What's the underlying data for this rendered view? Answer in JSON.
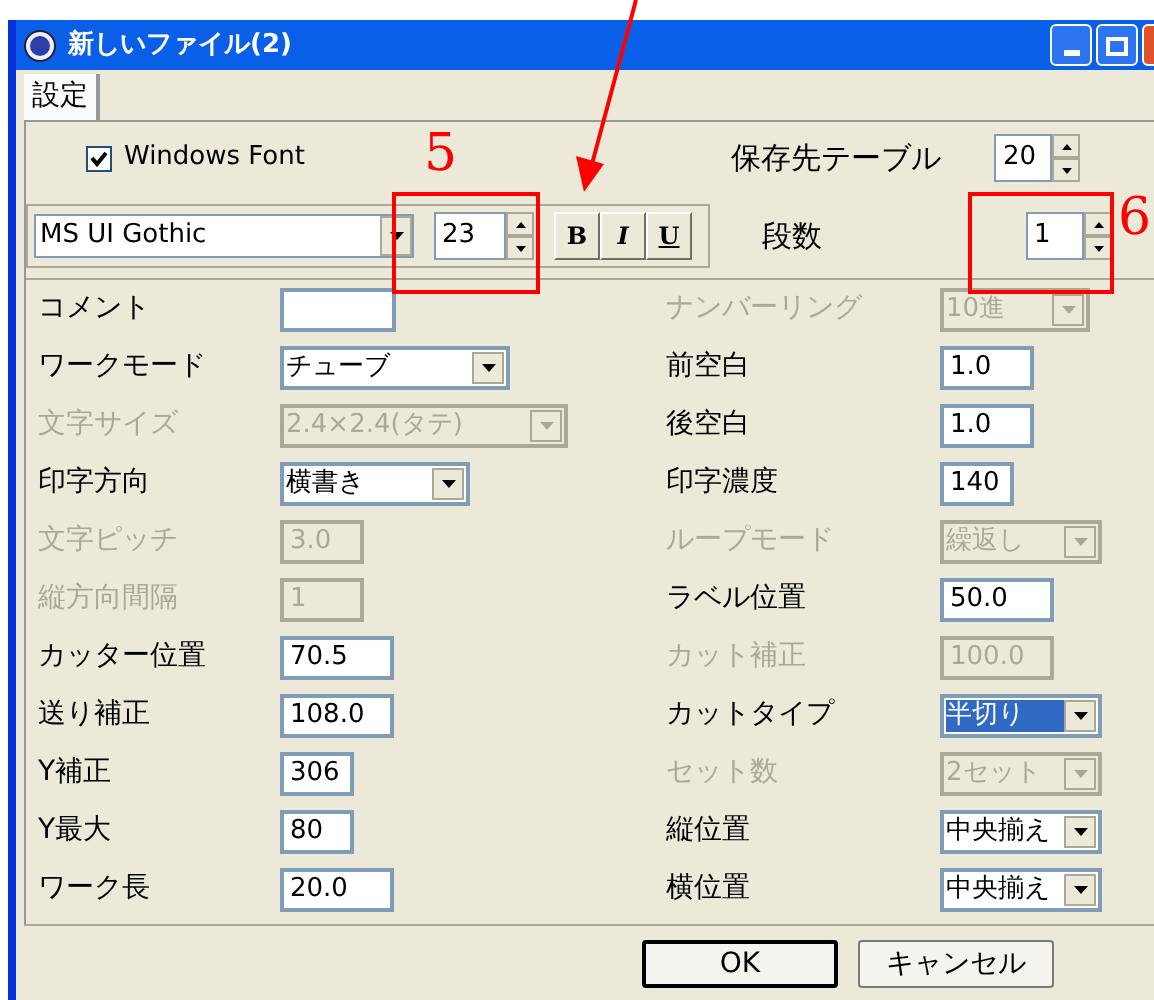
{
  "window": {
    "title": "新しいファイル(2)"
  },
  "tabs": [
    {
      "label": "設定",
      "selected": true
    }
  ],
  "windows_font": {
    "label": "Windows Font",
    "checked": true
  },
  "save_table": {
    "label": "保存先テーブル",
    "value": "20"
  },
  "font_row": {
    "font": "MS UI Gothic",
    "size": "23",
    "style_buttons": [
      "B",
      "I",
      "U"
    ]
  },
  "columns_count": {
    "label": "段数",
    "value": "1"
  },
  "left_fields": [
    {
      "label": "コメント",
      "kind": "text",
      "disabled": false
    },
    {
      "label": "ワークモード",
      "kind": "combo",
      "value": "チューブ",
      "disabled": false
    },
    {
      "label": "文字サイズ",
      "kind": "combo",
      "value": "2.4×2.4(タテ)",
      "disabled": true
    },
    {
      "label": "印字方向",
      "kind": "combo",
      "value": "横書き",
      "disabled": false
    },
    {
      "label": "文字ピッチ",
      "kind": "text",
      "value": "3.0",
      "disabled": true
    },
    {
      "label": "縦方向間隔",
      "kind": "text",
      "value": "1",
      "disabled": true
    },
    {
      "label": "カッター位置",
      "kind": "text",
      "value": "70.5",
      "disabled": false
    },
    {
      "label": "送り補正",
      "kind": "text",
      "value": "108.0",
      "disabled": false
    },
    {
      "label": "Y補正",
      "kind": "text",
      "value": "306",
      "disabled": false
    },
    {
      "label": "Y最大",
      "kind": "text",
      "value": "80",
      "disabled": false
    },
    {
      "label": "ワーク長",
      "kind": "text",
      "value": "20.0",
      "disabled": false
    }
  ],
  "right_fields": [
    {
      "label": "ナンバーリング",
      "kind": "combo",
      "value": "10進",
      "disabled": true
    },
    {
      "label": "前空白",
      "kind": "text",
      "value": "1.0",
      "disabled": false
    },
    {
      "label": "後空白",
      "kind": "text",
      "value": "1.0",
      "disabled": false
    },
    {
      "label": "印字濃度",
      "kind": "text",
      "value": "140",
      "disabled": false
    },
    {
      "label": "ループモード",
      "kind": "combo",
      "value": "繰返し",
      "disabled": true
    },
    {
      "label": "ラベル位置",
      "kind": "text",
      "value": "50.0",
      "disabled": false
    },
    {
      "label": "カット補正",
      "kind": "text",
      "value": "100.0",
      "disabled": true
    },
    {
      "label": "カットタイプ",
      "kind": "combo",
      "value": "半切り",
      "disabled": false,
      "highlighted": true
    },
    {
      "label": "セット数",
      "kind": "combo",
      "value": "2セット",
      "disabled": true
    },
    {
      "label": "縦位置",
      "kind": "combo",
      "value": "中央揃え",
      "disabled": false
    },
    {
      "label": "横位置",
      "kind": "combo",
      "value": "中央揃え",
      "disabled": false
    }
  ],
  "buttons": [
    {
      "label": "OK",
      "default": true
    },
    {
      "label": "キャンセル",
      "default": false
    }
  ],
  "annotations": [
    {
      "text": "5"
    },
    {
      "text": "6"
    }
  ]
}
